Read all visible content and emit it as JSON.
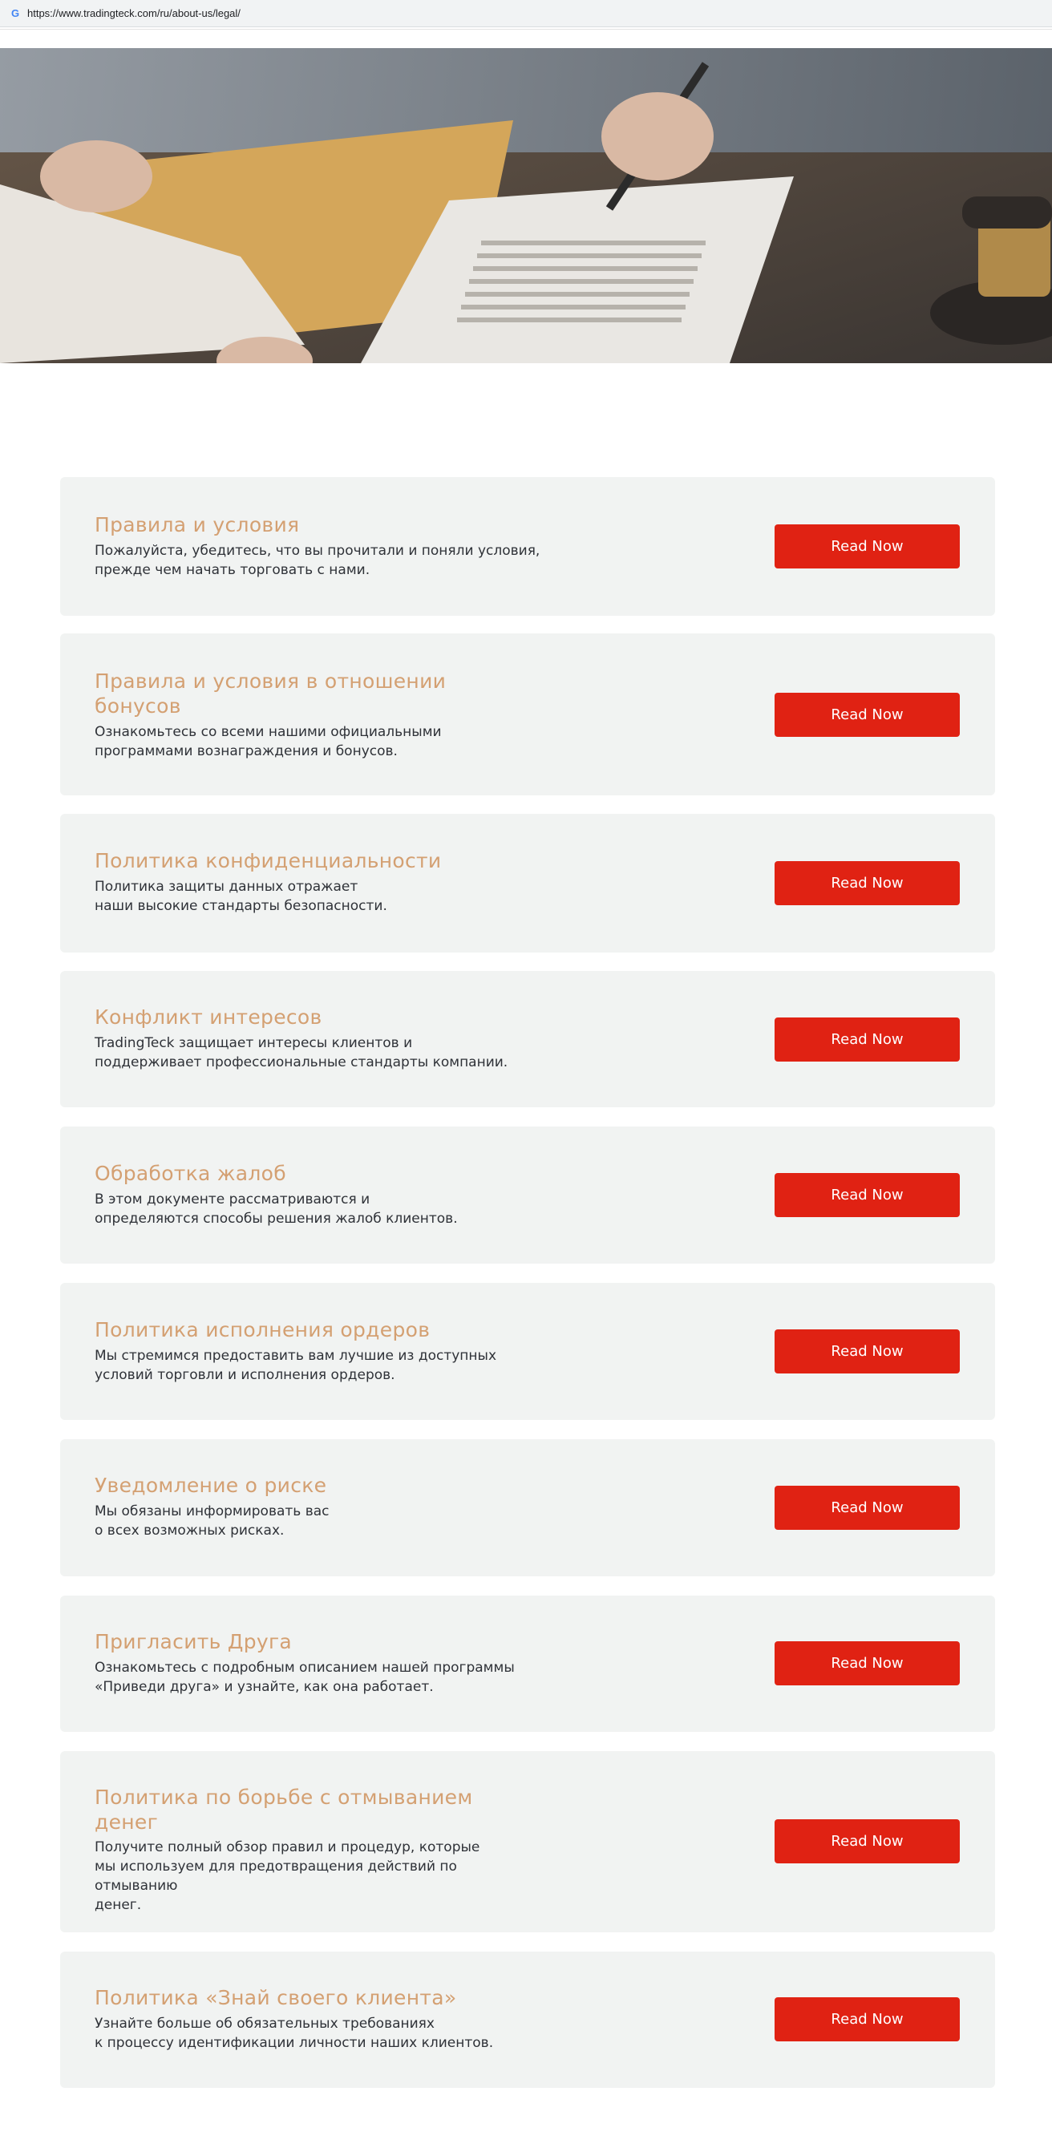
{
  "browser": {
    "url": "https://www.tradingteck.com/ru/about-us/legal/"
  },
  "hero": {
    "alt": "legal-documents-photo"
  },
  "cards": [
    {
      "title": "Правила и условия",
      "desc": "Пожалуйста, убедитесь, что вы прочитали и поняли условия,\nпрежде чем начать торговать с нами.",
      "button": "Read Now"
    },
    {
      "title": "Правила и условия в отношении бонусов",
      "desc": "Ознакомьтесь со всеми нашими официальными\nпрограммами вознаграждения и бонусов.",
      "button": "Read Now"
    },
    {
      "title": "Политика конфиденциальности",
      "desc": "Политика защиты данных отражает\nнаши высокие стандарты безопасности.",
      "button": "Read Now"
    },
    {
      "title": "Конфликт интересов",
      "desc": "TradingTeck защищает интересы клиентов и\nподдерживает профессиональные стандарты компании.",
      "button": "Read Now"
    },
    {
      "title": "Обработка жалоб",
      "desc": "В этом документе рассматриваются и\nопределяются способы решения жалоб клиентов.",
      "button": "Read Now"
    },
    {
      "title": "Политика исполнения ордеров",
      "desc": "Мы стремимся предоставить вам лучшие из доступных\nусловий торговли и исполнения ордеров.",
      "button": "Read Now"
    },
    {
      "title": "Уведомление о риске",
      "desc": "Мы обязаны информировать вас\nо всех возможных рисках.",
      "button": "Read Now"
    },
    {
      "title": "Пригласить Друга",
      "desc": "Ознакомьтесь с подробным описанием нашей программы\n«Приведи друга» и узнайте, как она работает.",
      "button": "Read Now"
    },
    {
      "title": "Политика по борьбе с отмыванием денег",
      "desc": "Получите полный обзор правил и процедур, которые\nмы используем для предотвращения действий по отмыванию\nденег.",
      "button": "Read Now"
    },
    {
      "title": "Политика «Знай своего клиента»",
      "desc": "Узнайте больше об обязательных требованиях\nк процессу идентификации личности наших клиентов.",
      "button": "Read Now"
    }
  ]
}
